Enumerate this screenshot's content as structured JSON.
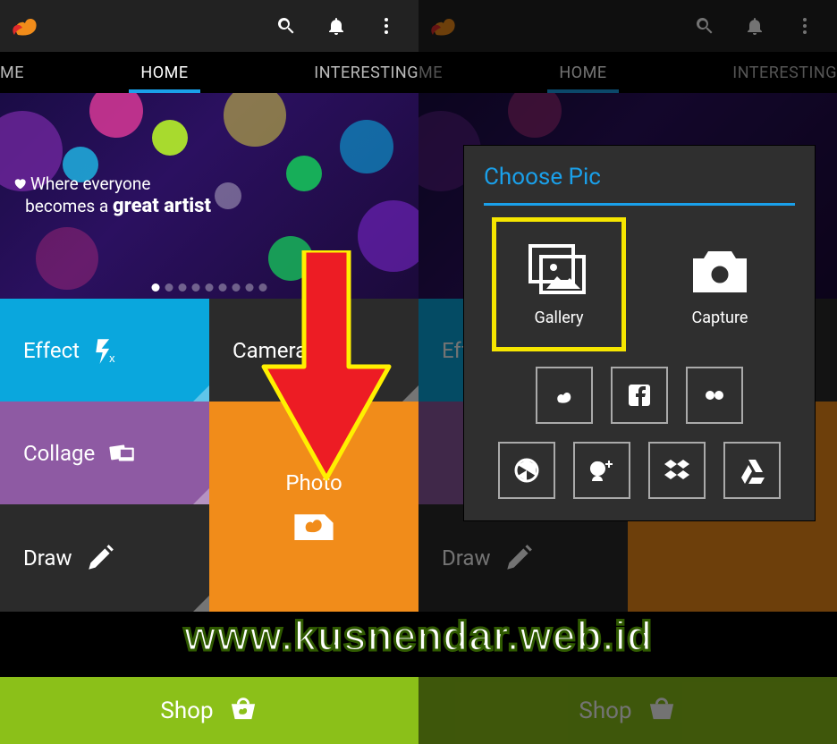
{
  "app": {
    "tabs": {
      "left": "ME",
      "home": "HOME",
      "right": "INTERESTING"
    }
  },
  "banner": {
    "line1": "Where everyone",
    "line2_a": "becomes a ",
    "line2_b": "great artist"
  },
  "tiles": {
    "effect": "Effect",
    "camera": "Camera",
    "collage": "Collage",
    "photo": "Photo",
    "draw": "Draw"
  },
  "shop": {
    "label": "Shop"
  },
  "dialog": {
    "title": "Choose Pic",
    "gallery": "Gallery",
    "capture": "Capture",
    "sources": [
      "picsart",
      "facebook",
      "flickr",
      "picasa",
      "google",
      "dropbox",
      "drive"
    ]
  },
  "watermark": "www.kusnendar.web.id"
}
